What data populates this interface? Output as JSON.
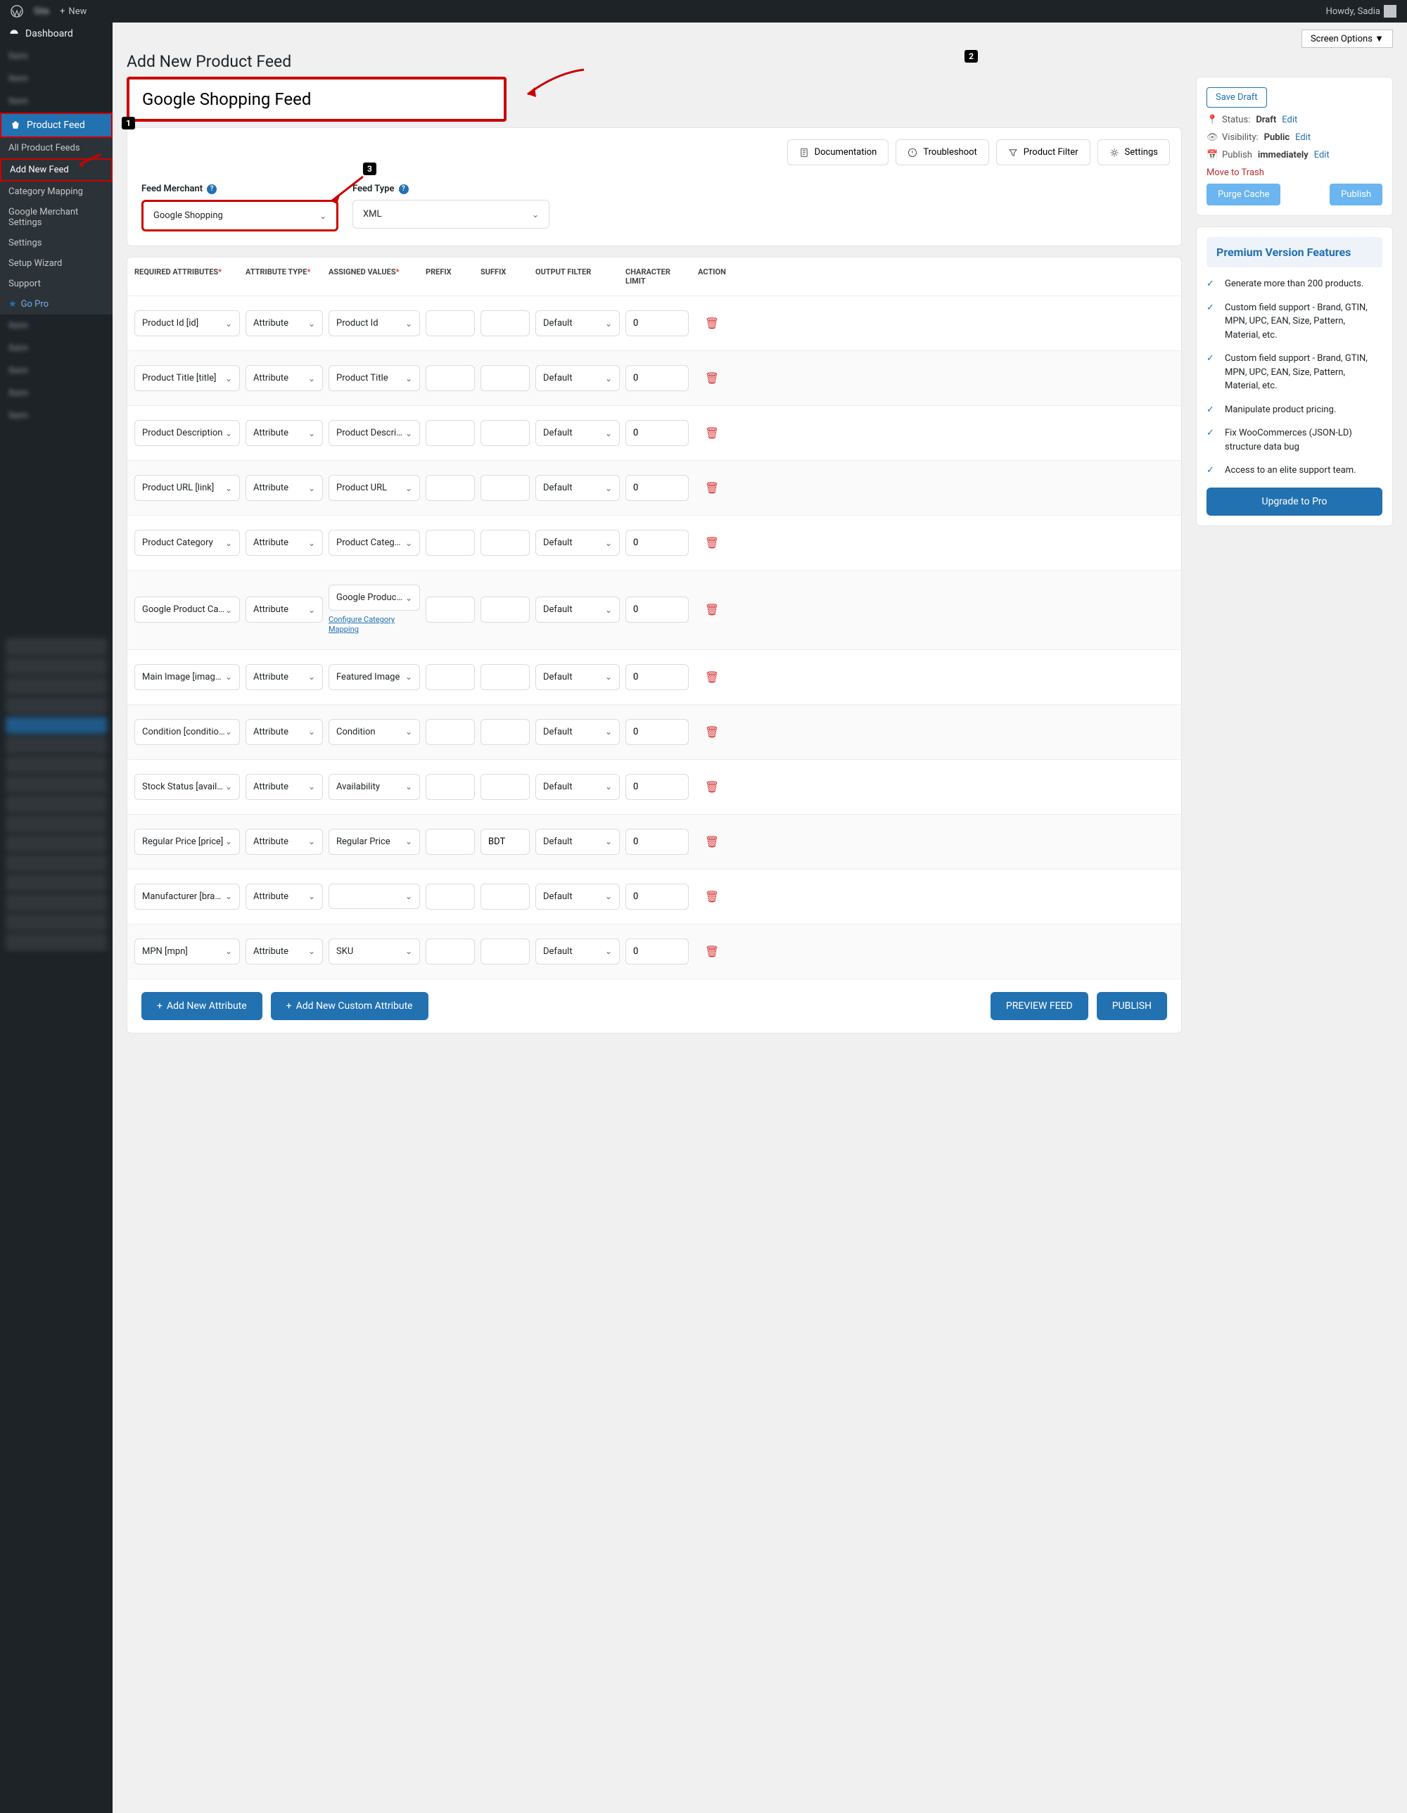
{
  "adminbar": {
    "new": "New",
    "howdy": "Howdy, Sadia"
  },
  "sidebar": {
    "dashboard": "Dashboard",
    "productFeed": "Product Feed",
    "sub": {
      "all": "All Product Feeds",
      "add": "Add New Feed",
      "cat": "Category Mapping",
      "gm": "Google Merchant Settings",
      "set": "Settings",
      "wiz": "Setup Wizard",
      "sup": "Support",
      "pro": "Go Pro"
    }
  },
  "screenOptions": "Screen Options ▼",
  "pageTitle": "Add New Product Feed",
  "feedTitle": "Google Shopping Feed",
  "toolbar": {
    "doc": "Documentation",
    "trouble": "Troubleshoot",
    "filter": "Product Filter",
    "settings": "Settings"
  },
  "merchant": {
    "label": "Feed Merchant",
    "value": "Google Shopping",
    "typeLabel": "Feed Type",
    "typeValue": "XML"
  },
  "headers": {
    "req": "REQUIRED ATTRIBUTES",
    "type": "ATTRIBUTE TYPE",
    "asn": "ASSIGNED VALUES",
    "pre": "PREFIX",
    "suf": "SUFFIX",
    "out": "OUTPUT FILTER",
    "lim": "CHARACTER LIMIT",
    "act": "ACTION"
  },
  "rows": [
    {
      "req": "Product Id [id]",
      "type": "Attribute",
      "asn": "Product Id",
      "pre": "",
      "suf": "",
      "out": "Default",
      "lim": "0"
    },
    {
      "req": "Product Title [title]",
      "type": "Attribute",
      "asn": "Product Title",
      "pre": "",
      "suf": "",
      "out": "Default",
      "lim": "0"
    },
    {
      "req": "Product Description",
      "type": "Attribute",
      "asn": "Product Description",
      "pre": "",
      "suf": "",
      "out": "Default",
      "lim": "0"
    },
    {
      "req": "Product URL [link]",
      "type": "Attribute",
      "asn": "Product URL",
      "pre": "",
      "suf": "",
      "out": "Default",
      "lim": "0"
    },
    {
      "req": "Product Category",
      "type": "Attribute",
      "asn": "Product Category",
      "pre": "",
      "suf": "",
      "out": "Default",
      "lim": "0"
    },
    {
      "req": "Google Product Category",
      "type": "Attribute",
      "asn": "Google Product Category",
      "pre": "",
      "suf": "",
      "out": "Default",
      "lim": "0",
      "conf": "Configure Category Mapping"
    },
    {
      "req": "Main Image [image_link]",
      "type": "Attribute",
      "asn": "Featured Image",
      "pre": "",
      "suf": "",
      "out": "Default",
      "lim": "0"
    },
    {
      "req": "Condition [condition]",
      "type": "Attribute",
      "asn": "Condition",
      "pre": "",
      "suf": "",
      "out": "Default",
      "lim": "0"
    },
    {
      "req": "Stock Status [availability]",
      "type": "Attribute",
      "asn": "Availability",
      "pre": "",
      "suf": "",
      "out": "Default",
      "lim": "0"
    },
    {
      "req": "Regular Price [price]",
      "type": "Attribute",
      "asn": "Regular Price",
      "pre": "",
      "suf": "BDT",
      "out": "Default",
      "lim": "0"
    },
    {
      "req": "Manufacturer [brand]",
      "type": "Attribute",
      "asn": "",
      "pre": "",
      "suf": "",
      "out": "Default",
      "lim": "0"
    },
    {
      "req": "MPN [mpn]",
      "type": "Attribute",
      "asn": "SKU",
      "pre": "",
      "suf": "",
      "out": "Default",
      "lim": "0"
    }
  ],
  "bottom": {
    "addAttr": "Add New Attribute",
    "addCustom": "Add New Custom Attribute",
    "preview": "PREVIEW FEED",
    "publish": "PUBLISH"
  },
  "publish": {
    "saveDraft": "Save Draft",
    "statusLabel": "Status:",
    "statusVal": "Draft",
    "edit": "Edit",
    "visLabel": "Visibility:",
    "visVal": "Public",
    "pubLabel": "Publish",
    "pubVal": "immediately",
    "trash": "Move to Trash",
    "purge": "Purge Cache",
    "pubBtn": "Publish"
  },
  "premium": {
    "title": "Premium Version Features",
    "items": [
      "Generate more than 200 products.",
      "Custom field support - Brand, GTIN, MPN, UPC, EAN, Size, Pattern, Material, etc.",
      "Custom field support - Brand, GTIN, MPN, UPC, EAN, Size, Pattern, Material, etc.",
      "Manipulate product pricing.",
      "Fix WooCommerces (JSON-LD) structure data bug",
      "Access to an elite support team."
    ],
    "upgrade": "Upgrade to Pro"
  },
  "annotations": {
    "a1": "1",
    "a2": "2",
    "a3": "3"
  }
}
